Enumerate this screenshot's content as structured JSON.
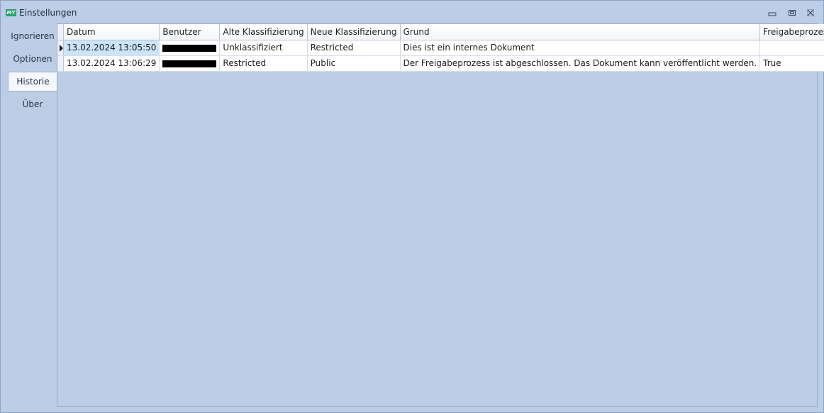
{
  "window": {
    "title": "Einstellungen",
    "app_icon_text": "MY",
    "icon_accent": "#2aa36a",
    "controls": [
      "minimize-icon",
      "restore-icon",
      "close-icon"
    ]
  },
  "tabs": [
    {
      "label": "Ignorieren",
      "active": false
    },
    {
      "label": "Optionen",
      "active": false
    },
    {
      "label": "Historie",
      "active": true
    },
    {
      "label": "Über",
      "active": false
    }
  ],
  "history_table": {
    "columns": [
      "Datum",
      "Benutzer",
      "Alte Klassifizierung",
      "Neue Klassifizierung",
      "Grund",
      "Freigabeprozess"
    ],
    "sorted_column": "Freigabeprozess",
    "sort_direction": "ascending",
    "rows": [
      {
        "datum": "13.02.2024 13:05:50",
        "benutzer": "",
        "alte": "Unklassifiziert",
        "neue": "Restricted",
        "grund": "Dies ist ein internes Dokument",
        "freigabe": ""
      },
      {
        "datum": "13.02.2024 13:06:29",
        "benutzer": "",
        "alte": "Restricted",
        "neue": "Public",
        "grund": "Der Freigabeprozess ist abgeschlossen. Das Dokument kann veröffentlicht werden.",
        "freigabe": "True"
      }
    ]
  }
}
